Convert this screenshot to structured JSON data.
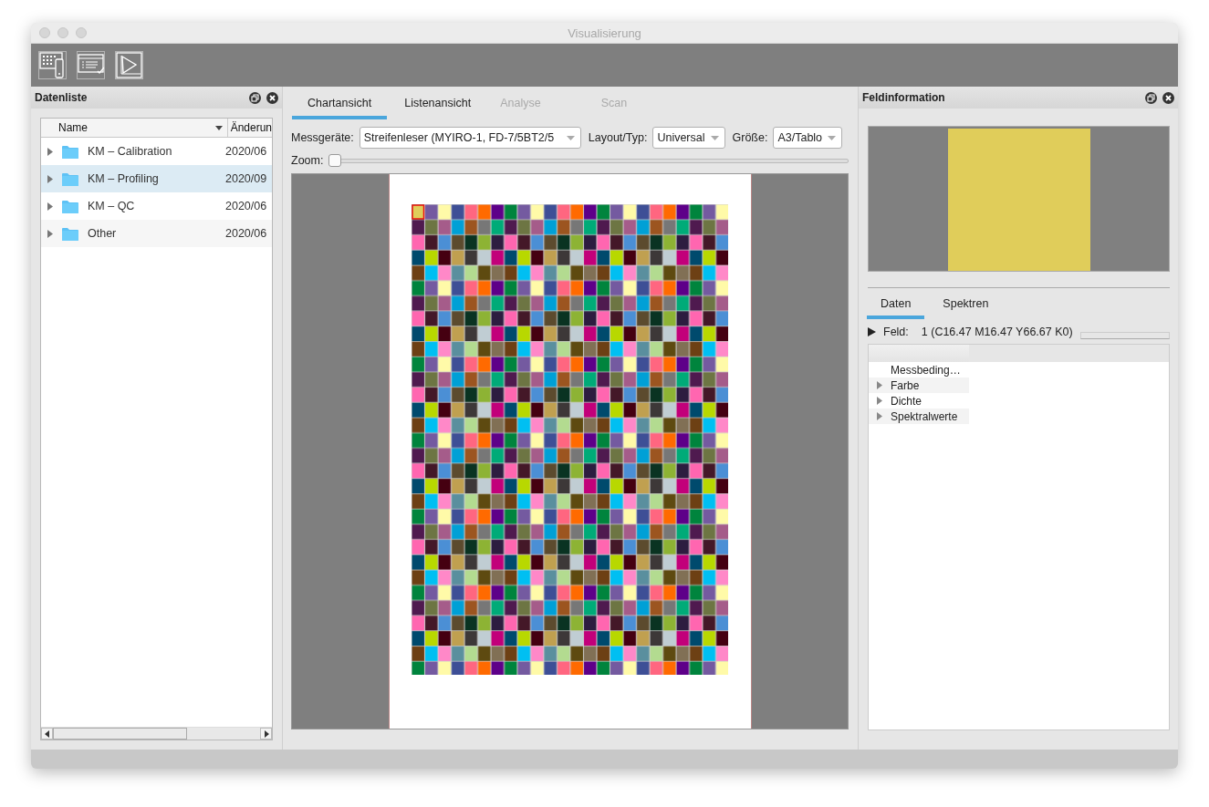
{
  "window": {
    "title": "Visualisierung"
  },
  "toolbar": {
    "buttons": [
      {
        "kind": "chart"
      },
      {
        "kind": "list"
      },
      {
        "kind": "gamut"
      }
    ]
  },
  "data_list": {
    "title": "Datenliste",
    "columns": [
      "Name",
      "Änderun"
    ],
    "rows": [
      {
        "name": "KM – Calibration",
        "date": "2020/06",
        "selected": false
      },
      {
        "name": "KM – Profiling",
        "date": "2020/09",
        "selected": true
      },
      {
        "name": "KM – QC",
        "date": "2020/06",
        "selected": false
      },
      {
        "name": "Other",
        "date": "2020/06",
        "selected": false
      }
    ]
  },
  "center": {
    "tabs": [
      {
        "label": "Chartansicht",
        "selected": true,
        "disabled": false
      },
      {
        "label": "Listenansicht",
        "selected": false,
        "disabled": false
      },
      {
        "label": "Analyse",
        "selected": false,
        "disabled": true
      },
      {
        "label": "Scan",
        "selected": false,
        "disabled": true
      }
    ],
    "fields": [
      {
        "label": "Messgeräte:",
        "value": "Streifenleser (MYIRO-1, FD-7/5BT2/5"
      },
      {
        "label": "Layout/Typ:",
        "value": "Universal"
      },
      {
        "label": "Größe:",
        "value": "A3/Tablo"
      }
    ],
    "zoom": {
      "label": "Zoom:",
      "level": 0
    }
  },
  "field_info": {
    "title": "Feldinformation",
    "swatch": {
      "color": "#e0cd5a"
    },
    "tabs": [
      {
        "label": "Daten",
        "selected": true
      },
      {
        "label": "Spektren",
        "selected": false
      }
    ],
    "field_label": "Feld:",
    "field_value": "1 (C16.47 M16.47 Y66.67 K0)",
    "tree": [
      {
        "label": "Messbeding…",
        "expandable": false
      },
      {
        "label": "Farbe",
        "expandable": true
      },
      {
        "label": "Dichte",
        "expandable": true
      },
      {
        "label": "Spektralwerte",
        "expandable": true
      }
    ]
  }
}
